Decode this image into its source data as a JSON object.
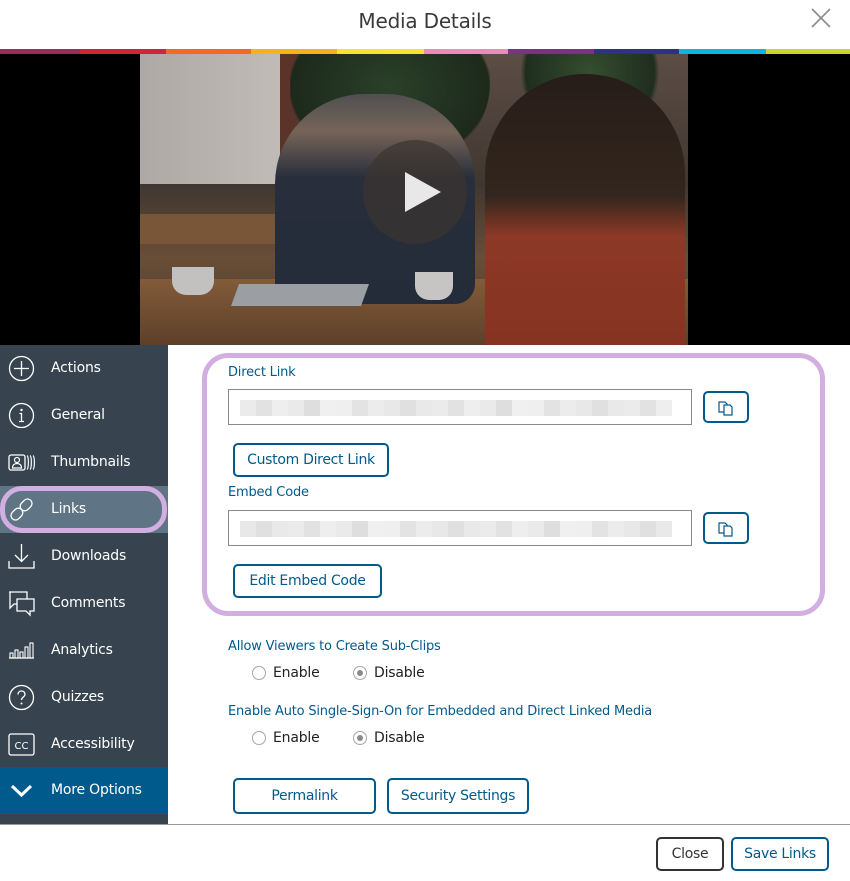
{
  "dialog": {
    "title": "Media Details",
    "close_icon": "close-x-icon"
  },
  "colors": {
    "accent": "#005a8c",
    "sidebar_bg": "#37444f",
    "sidebar_active_bg": "#5f7585",
    "highlight_ring": "#d2aee1",
    "stripe": [
      "#9b2c5a",
      "#d2233a",
      "#ee6b24",
      "#f9b11b",
      "#fde12a",
      "#ee8ab8",
      "#7f2f8a",
      "#2e3185",
      "#0bb7e2",
      "#c8d532"
    ]
  },
  "video": {
    "play_icon": "play-icon"
  },
  "sidebar": {
    "items": [
      {
        "label": "Actions",
        "icon": "plus-circle-icon"
      },
      {
        "label": "General",
        "icon": "info-circle-icon"
      },
      {
        "label": "Thumbnails",
        "icon": "thumbnails-icon"
      },
      {
        "label": "Links",
        "icon": "link-icon",
        "active": true
      },
      {
        "label": "Downloads",
        "icon": "download-icon"
      },
      {
        "label": "Comments",
        "icon": "comments-icon"
      },
      {
        "label": "Analytics",
        "icon": "bar-chart-icon"
      },
      {
        "label": "Quizzes",
        "icon": "question-circle-icon"
      },
      {
        "label": "Accessibility",
        "icon": "closed-caption-icon"
      },
      {
        "label": "More Options",
        "icon": "chevron-down-icon"
      }
    ]
  },
  "links": {
    "direct_link": {
      "label": "Direct Link",
      "value": "[redacted]",
      "copy_icon": "copy-icon",
      "button_label": "Custom Direct Link"
    },
    "embed_code": {
      "label": "Embed Code",
      "value": "[redacted]",
      "copy_icon": "copy-icon",
      "button_label": "Edit Embed Code"
    }
  },
  "options": {
    "subclips": {
      "label": "Allow Viewers to Create Sub-Clips",
      "choices": [
        "Enable",
        "Disable"
      ],
      "selected": "Disable"
    },
    "sso": {
      "label": "Enable Auto Single-Sign-On for Embedded and Direct Linked Media",
      "choices": [
        "Enable",
        "Disable"
      ],
      "selected": "Disable"
    }
  },
  "actions": {
    "permalink": "Permalink",
    "security_settings": "Security Settings"
  },
  "footer": {
    "close": "Close",
    "save": "Save Links"
  }
}
